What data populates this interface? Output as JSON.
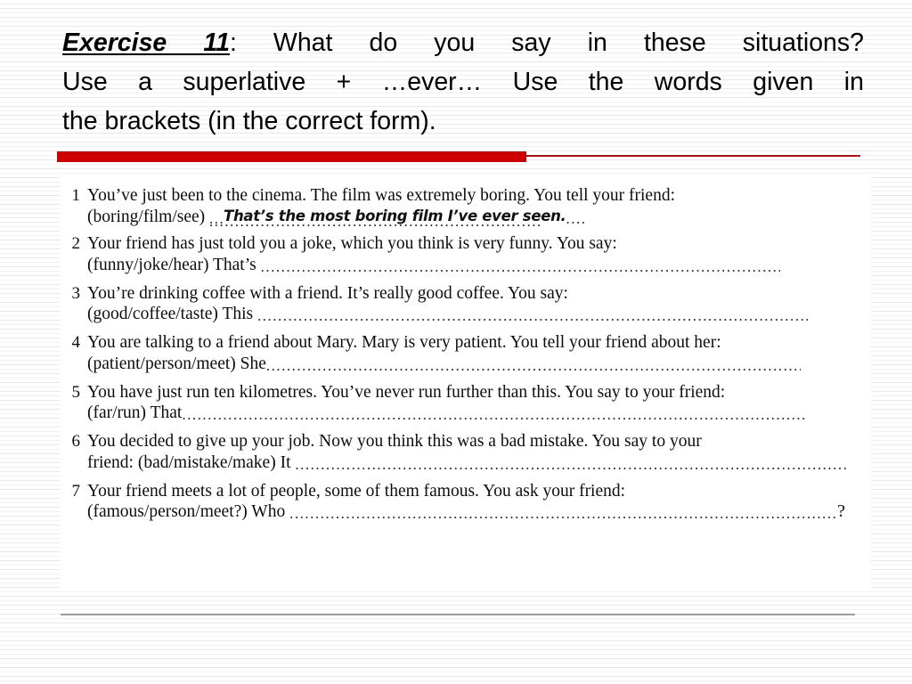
{
  "slide": {
    "header": {
      "title_word": "Exercise 11",
      "line1_rest": ": What do you say in these situations?",
      "line2": "Use a superlative + …ever… Use the words given in",
      "line3": "the brackets (in the correct form).",
      "full_text": "Exercise 11: What do you say in these situations? Use a superlative + …ever… Use the words given in the brackets (in the correct form)."
    },
    "divider": {
      "accent_color": "#cc0000",
      "thin_color": "#a81414"
    },
    "exercise": {
      "items": [
        {
          "number": "1",
          "prompt": "You’ve just been to the cinema. The film was extremely boring. You tell your friend:",
          "cue": "(boring/film/see) ",
          "lead": "",
          "answer": "That’s the most boring film I’ve ever seen.",
          "tail": ""
        },
        {
          "number": "2",
          "prompt": "Your friend has just told you a joke, which you think is very funny. You say:",
          "cue": "(funny/joke/hear) ",
          "lead": "That’s ",
          "answer": "",
          "tail": ""
        },
        {
          "number": "3",
          "prompt": "You’re drinking coffee with a friend. It’s really good coffee. You say:",
          "cue": "(good/coffee/taste) ",
          "lead": "This ",
          "answer": "",
          "tail": ""
        },
        {
          "number": "4",
          "prompt": "You are talking to a friend about Mary. Mary is very patient. You tell your friend about her:",
          "cue": "(patient/person/meet) ",
          "lead": "She",
          "answer": "",
          "tail": ""
        },
        {
          "number": "5",
          "prompt": "You have just run ten kilometres. You’ve never run further than this. You say to your friend:",
          "cue": "(far/run) ",
          "lead": "That",
          "answer": "",
          "tail": ""
        },
        {
          "number": "6",
          "prompt": "You decided to give up your job. Now you think this was a bad mistake. You say to your",
          "cue": "friend: (bad/mistake/make) ",
          "lead": "It ",
          "answer": "",
          "tail": ""
        },
        {
          "number": "7",
          "prompt": "Your friend meets a lot of people, some of them famous. You ask your friend:",
          "cue": "(famous/person/meet?) ",
          "lead": "Who ",
          "answer": "",
          "tail": "?"
        }
      ]
    }
  }
}
